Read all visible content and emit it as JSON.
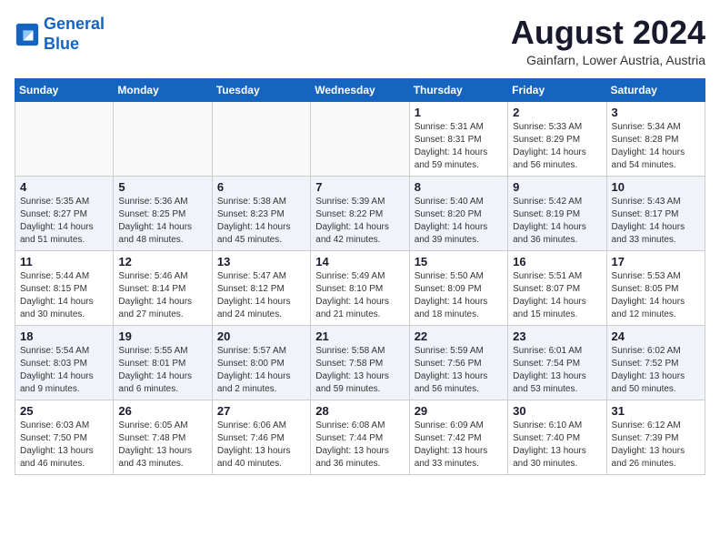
{
  "logo": {
    "text_general": "General",
    "text_blue": "Blue"
  },
  "title": {
    "month_year": "August 2024",
    "location": "Gainfarn, Lower Austria, Austria"
  },
  "weekdays": [
    "Sunday",
    "Monday",
    "Tuesday",
    "Wednesday",
    "Thursday",
    "Friday",
    "Saturday"
  ],
  "weeks": [
    [
      {
        "day": "",
        "info": ""
      },
      {
        "day": "",
        "info": ""
      },
      {
        "day": "",
        "info": ""
      },
      {
        "day": "",
        "info": ""
      },
      {
        "day": "1",
        "info": "Sunrise: 5:31 AM\nSunset: 8:31 PM\nDaylight: 14 hours\nand 59 minutes."
      },
      {
        "day": "2",
        "info": "Sunrise: 5:33 AM\nSunset: 8:29 PM\nDaylight: 14 hours\nand 56 minutes."
      },
      {
        "day": "3",
        "info": "Sunrise: 5:34 AM\nSunset: 8:28 PM\nDaylight: 14 hours\nand 54 minutes."
      }
    ],
    [
      {
        "day": "4",
        "info": "Sunrise: 5:35 AM\nSunset: 8:27 PM\nDaylight: 14 hours\nand 51 minutes."
      },
      {
        "day": "5",
        "info": "Sunrise: 5:36 AM\nSunset: 8:25 PM\nDaylight: 14 hours\nand 48 minutes."
      },
      {
        "day": "6",
        "info": "Sunrise: 5:38 AM\nSunset: 8:23 PM\nDaylight: 14 hours\nand 45 minutes."
      },
      {
        "day": "7",
        "info": "Sunrise: 5:39 AM\nSunset: 8:22 PM\nDaylight: 14 hours\nand 42 minutes."
      },
      {
        "day": "8",
        "info": "Sunrise: 5:40 AM\nSunset: 8:20 PM\nDaylight: 14 hours\nand 39 minutes."
      },
      {
        "day": "9",
        "info": "Sunrise: 5:42 AM\nSunset: 8:19 PM\nDaylight: 14 hours\nand 36 minutes."
      },
      {
        "day": "10",
        "info": "Sunrise: 5:43 AM\nSunset: 8:17 PM\nDaylight: 14 hours\nand 33 minutes."
      }
    ],
    [
      {
        "day": "11",
        "info": "Sunrise: 5:44 AM\nSunset: 8:15 PM\nDaylight: 14 hours\nand 30 minutes."
      },
      {
        "day": "12",
        "info": "Sunrise: 5:46 AM\nSunset: 8:14 PM\nDaylight: 14 hours\nand 27 minutes."
      },
      {
        "day": "13",
        "info": "Sunrise: 5:47 AM\nSunset: 8:12 PM\nDaylight: 14 hours\nand 24 minutes."
      },
      {
        "day": "14",
        "info": "Sunrise: 5:49 AM\nSunset: 8:10 PM\nDaylight: 14 hours\nand 21 minutes."
      },
      {
        "day": "15",
        "info": "Sunrise: 5:50 AM\nSunset: 8:09 PM\nDaylight: 14 hours\nand 18 minutes."
      },
      {
        "day": "16",
        "info": "Sunrise: 5:51 AM\nSunset: 8:07 PM\nDaylight: 14 hours\nand 15 minutes."
      },
      {
        "day": "17",
        "info": "Sunrise: 5:53 AM\nSunset: 8:05 PM\nDaylight: 14 hours\nand 12 minutes."
      }
    ],
    [
      {
        "day": "18",
        "info": "Sunrise: 5:54 AM\nSunset: 8:03 PM\nDaylight: 14 hours\nand 9 minutes."
      },
      {
        "day": "19",
        "info": "Sunrise: 5:55 AM\nSunset: 8:01 PM\nDaylight: 14 hours\nand 6 minutes."
      },
      {
        "day": "20",
        "info": "Sunrise: 5:57 AM\nSunset: 8:00 PM\nDaylight: 14 hours\nand 2 minutes."
      },
      {
        "day": "21",
        "info": "Sunrise: 5:58 AM\nSunset: 7:58 PM\nDaylight: 13 hours\nand 59 minutes."
      },
      {
        "day": "22",
        "info": "Sunrise: 5:59 AM\nSunset: 7:56 PM\nDaylight: 13 hours\nand 56 minutes."
      },
      {
        "day": "23",
        "info": "Sunrise: 6:01 AM\nSunset: 7:54 PM\nDaylight: 13 hours\nand 53 minutes."
      },
      {
        "day": "24",
        "info": "Sunrise: 6:02 AM\nSunset: 7:52 PM\nDaylight: 13 hours\nand 50 minutes."
      }
    ],
    [
      {
        "day": "25",
        "info": "Sunrise: 6:03 AM\nSunset: 7:50 PM\nDaylight: 13 hours\nand 46 minutes."
      },
      {
        "day": "26",
        "info": "Sunrise: 6:05 AM\nSunset: 7:48 PM\nDaylight: 13 hours\nand 43 minutes."
      },
      {
        "day": "27",
        "info": "Sunrise: 6:06 AM\nSunset: 7:46 PM\nDaylight: 13 hours\nand 40 minutes."
      },
      {
        "day": "28",
        "info": "Sunrise: 6:08 AM\nSunset: 7:44 PM\nDaylight: 13 hours\nand 36 minutes."
      },
      {
        "day": "29",
        "info": "Sunrise: 6:09 AM\nSunset: 7:42 PM\nDaylight: 13 hours\nand 33 minutes."
      },
      {
        "day": "30",
        "info": "Sunrise: 6:10 AM\nSunset: 7:40 PM\nDaylight: 13 hours\nand 30 minutes."
      },
      {
        "day": "31",
        "info": "Sunrise: 6:12 AM\nSunset: 7:39 PM\nDaylight: 13 hours\nand 26 minutes."
      }
    ]
  ]
}
